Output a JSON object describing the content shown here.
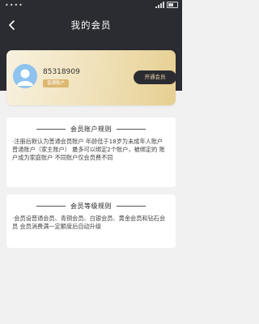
{
  "status_bar": {
    "left": "••••",
    "right": ""
  },
  "header": {
    "title": "我的会员"
  },
  "member_card": {
    "user_id": "85318909",
    "account_type": "普通账户",
    "open_button": "开通会员"
  },
  "account_rules": {
    "title": "会员账户规则",
    "body": "·注册后默认为普通会员账户 年龄低于18岁为未成年人账户 普通账户（家主账户） 最多可以绑定2个账户，被绑定的 账户成为家庭账户 不同账户仅会员费不同"
  },
  "level_rules": {
    "title": "会员等级规则",
    "body": "·会员设普通会员、青铜会员、白银会员、黄金会员和钻石会员  会员消费满一定额度后自动升级"
  },
  "colors": {
    "header_bg": "#2b2c32",
    "card_gold": "#e6cf91",
    "badge": "#dcb870",
    "button_bg": "#2b2c32",
    "page_bg": "#f1f1f1"
  }
}
